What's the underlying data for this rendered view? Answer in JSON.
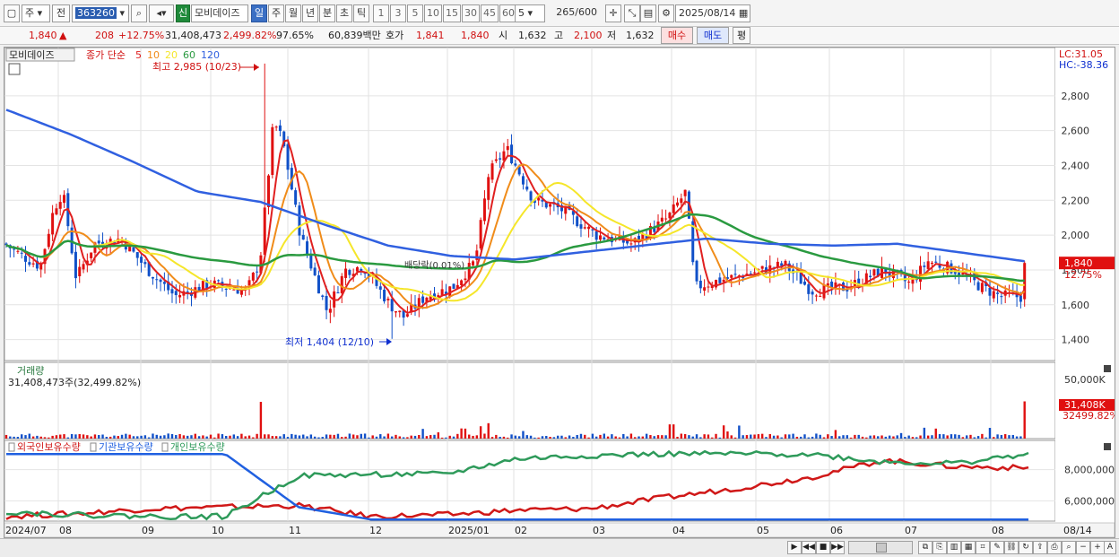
{
  "toolbar": {
    "period_primary": "주",
    "prev_label": "전",
    "code": "363260",
    "new_badge": "신",
    "stock_name": "모비데이즈",
    "period_tabs": [
      "일",
      "주",
      "월",
      "년",
      "분",
      "초",
      "틱"
    ],
    "period_active": "일",
    "interval_buttons": [
      "1",
      "3",
      "5",
      "10",
      "15",
      "30",
      "45",
      "60"
    ],
    "interval_value": "5",
    "count_value": "265",
    "count_total": "/600",
    "date_value": "2025/08/14"
  },
  "quote": {
    "price": "1,840",
    "change_arrow": "▲",
    "change": "208",
    "change_pct": "+12.75%",
    "volume": "31,408,473",
    "volume_pct": "2,499.82%",
    "ratio": "97.65%",
    "amount": "60,839백만",
    "hoga_label": "호가",
    "ask": "1,841",
    "bid": "1,840",
    "open_label": "시",
    "open": "1,632",
    "high_label": "고",
    "high": "2,100",
    "low_label": "저",
    "low": "1,632",
    "buy_label": "매수",
    "sell_label": "매도",
    "eval_label": "평"
  },
  "colors": {
    "candle_up": "#e01010",
    "candle_down": "#1050c8",
    "ma5": "#e02020",
    "ma10": "#f08c1a",
    "ma20": "#f5e62a",
    "ma60": "#2a9a40",
    "ma120": "#3060e0",
    "foreign": "#d01818",
    "institution": "#2060e0",
    "individual": "#2e9a5a"
  },
  "price_panel": {
    "stock_tab": "모비데이즈",
    "legend_title": "종가 단순",
    "legend_ma": [
      "5",
      "10",
      "20",
      "60",
      "120"
    ],
    "lc_label": "LC:31.05",
    "hc_label": "HC:-38.36",
    "max_annotation": "최고 2,985 (10/23)",
    "min_annotation": "최저 1,404 (12/10)",
    "event_label": "배당락(0.01%)",
    "current_price_tag": "1,840",
    "current_pct_tag": "12.75%"
  },
  "volume_panel": {
    "title": "거래량",
    "value": "31,408,473주(32,499.82%)",
    "tag": "31,408K",
    "tag_pct": "32499.82%"
  },
  "holdings_panel": {
    "legend": [
      "외국인보유수량",
      "기관보유수량",
      "개인보유수량"
    ]
  },
  "x_axis": [
    "2024/07",
    "08",
    "09",
    "10",
    "11",
    "12",
    "2025/01",
    "02",
    "03",
    "04",
    "05",
    "06",
    "07",
    "08",
    "08/14"
  ],
  "chart_data": [
    {
      "type": "line",
      "title": "",
      "ylim": [
        1300,
        3000
      ],
      "y_ticks": [
        "2,800",
        "2,600",
        "2,400",
        "2,200",
        "2,000",
        "1,800",
        "1,600",
        "1,400"
      ],
      "y_tick_values": [
        2800,
        2600,
        2400,
        2200,
        2000,
        1800,
        1600,
        1400
      ],
      "x": [
        "2024/07",
        "08",
        "09",
        "10",
        "10/23",
        "11",
        "12/10",
        "12",
        "2025/01",
        "02",
        "03",
        "04",
        "05",
        "06",
        "07",
        "08",
        "08/14"
      ],
      "series": [
        {
          "name": "5",
          "values": [
            1900,
            1950,
            1820,
            1680,
            2600,
            1750,
            1520,
            1650,
            2450,
            2150,
            1980,
            2200,
            1720,
            1720,
            1820,
            1660,
            1840
          ]
        },
        {
          "name": "120",
          "values": [
            2720,
            2580,
            2420,
            2250,
            2190,
            2060,
            1940,
            1880,
            1860,
            1900,
            1940,
            1980,
            1950,
            1940,
            1950,
            1900,
            1850
          ]
        }
      ],
      "annotations": {
        "max": 2985,
        "min": 1404,
        "last": 1840
      }
    },
    {
      "type": "bar",
      "title": "",
      "y_ticks": [
        "50,000K",
        "30,000K"
      ],
      "y_tick_values": [
        50000,
        30000
      ],
      "x": [
        "2024/07",
        "08",
        "09",
        "10",
        "10/23",
        "11",
        "12",
        "2025/01",
        "02",
        "03",
        "04",
        "05",
        "06",
        "07",
        "08",
        "08/14"
      ],
      "values": [
        2000,
        8000,
        1500,
        2500,
        31000,
        3000,
        2500,
        6000,
        13000,
        3000,
        12000,
        2500,
        1500,
        2000,
        1500,
        31408
      ]
    },
    {
      "type": "line",
      "title": "",
      "y_ticks": [
        "8,000,000",
        "6,000,000"
      ],
      "y_tick_values": [
        8000000,
        6000000
      ],
      "x": [
        "2024/07",
        "08",
        "09",
        "10",
        "11",
        "12",
        "2025/01",
        "02",
        "03",
        "04",
        "05",
        "06",
        "07",
        "08",
        "08/14"
      ],
      "series": [
        {
          "name": "외국인보유수량",
          "values": [
            5000000,
            5200000,
            5500000,
            5600000,
            5700000,
            5000000,
            5100000,
            5400000,
            5500000,
            6200000,
            6800000,
            7500000,
            8600000,
            8200000,
            8100000
          ]
        },
        {
          "name": "기관보유수량",
          "values": [
            9000000,
            9000000,
            9000000,
            9000000,
            5600000,
            4800000,
            4800000,
            4800000,
            4800000,
            4800000,
            4800000,
            4800000,
            4800000,
            4800000,
            4800000
          ]
        },
        {
          "name": "개인보유수량",
          "values": [
            5300000,
            5100000,
            5000000,
            5000000,
            7600000,
            7700000,
            7700000,
            8700000,
            8900000,
            9000000,
            9000000,
            9000000,
            8500000,
            8400000,
            9000000
          ]
        }
      ]
    }
  ]
}
